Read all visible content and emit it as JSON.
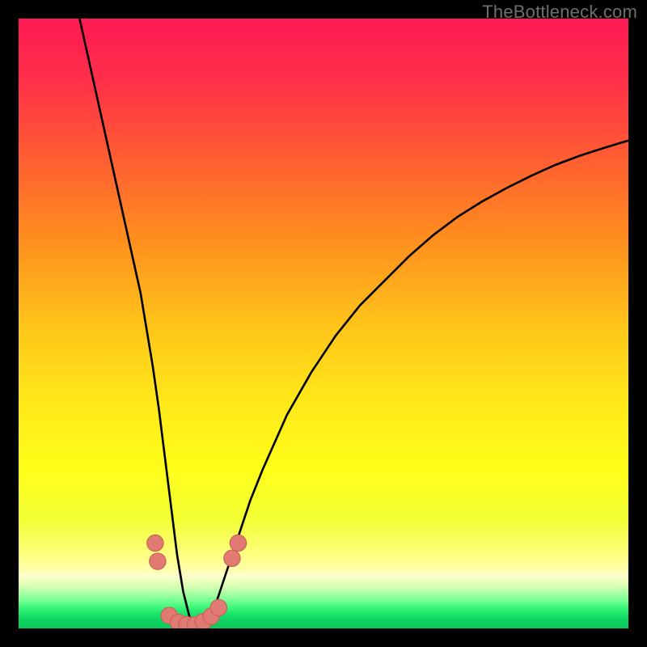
{
  "watermark": "TheBottleneck.com",
  "colors": {
    "black": "#000000",
    "curve": "#000000",
    "marker_fill": "#e07a72",
    "marker_stroke": "#c95f57",
    "gradient_stops": [
      {
        "offset": 0.0,
        "color": "#ff1a54"
      },
      {
        "offset": 0.1,
        "color": "#ff2f4a"
      },
      {
        "offset": 0.22,
        "color": "#ff5a33"
      },
      {
        "offset": 0.35,
        "color": "#ff8a1f"
      },
      {
        "offset": 0.5,
        "color": "#ffc31a"
      },
      {
        "offset": 0.62,
        "color": "#ffe61a"
      },
      {
        "offset": 0.74,
        "color": "#ffff1a"
      },
      {
        "offset": 0.82,
        "color": "#f2ff33"
      },
      {
        "offset": 0.88,
        "color": "#ffff80"
      },
      {
        "offset": 0.905,
        "color": "#ffffb0"
      },
      {
        "offset": 0.915,
        "color": "#fbffd0"
      },
      {
        "offset": 0.925,
        "color": "#e6ffb8"
      },
      {
        "offset": 0.935,
        "color": "#c8ffb0"
      },
      {
        "offset": 0.945,
        "color": "#9effa0"
      },
      {
        "offset": 0.955,
        "color": "#70ff90"
      },
      {
        "offset": 0.965,
        "color": "#40f77a"
      },
      {
        "offset": 0.975,
        "color": "#1fe76c"
      },
      {
        "offset": 0.985,
        "color": "#10d562"
      },
      {
        "offset": 1.0,
        "color": "#0acb5d"
      }
    ]
  },
  "chart_data": {
    "type": "line",
    "title": "",
    "xlabel": "",
    "ylabel": "",
    "xlim": [
      0,
      100
    ],
    "ylim": [
      0,
      100
    ],
    "x": [
      10,
      12,
      14,
      16,
      18,
      20,
      21,
      22,
      23,
      24,
      25,
      26,
      27,
      28,
      29,
      30,
      31,
      32,
      34,
      36,
      38,
      40,
      44,
      48,
      52,
      56,
      60,
      64,
      68,
      72,
      76,
      80,
      84,
      88,
      92,
      96,
      100
    ],
    "values": [
      100,
      91,
      82,
      73,
      64,
      55,
      49,
      43,
      36,
      28,
      20,
      12,
      6,
      2,
      0,
      0,
      1,
      3,
      9,
      15,
      21,
      26,
      35,
      42,
      48,
      53,
      57,
      61,
      64.5,
      67.5,
      70,
      72.2,
      74.2,
      76,
      77.5,
      78.8,
      80
    ],
    "markers": [
      {
        "x": 22.4,
        "y": 14
      },
      {
        "x": 22.8,
        "y": 11
      },
      {
        "x": 24.7,
        "y": 2.1
      },
      {
        "x": 26.2,
        "y": 1.0
      },
      {
        "x": 27.6,
        "y": 0.6
      },
      {
        "x": 29.0,
        "y": 0.6
      },
      {
        "x": 30.3,
        "y": 1.1
      },
      {
        "x": 31.6,
        "y": 2.0
      },
      {
        "x": 32.8,
        "y": 3.4
      },
      {
        "x": 35.0,
        "y": 11.5
      },
      {
        "x": 36.0,
        "y": 14.0
      }
    ],
    "marker_radius": 1.35
  }
}
